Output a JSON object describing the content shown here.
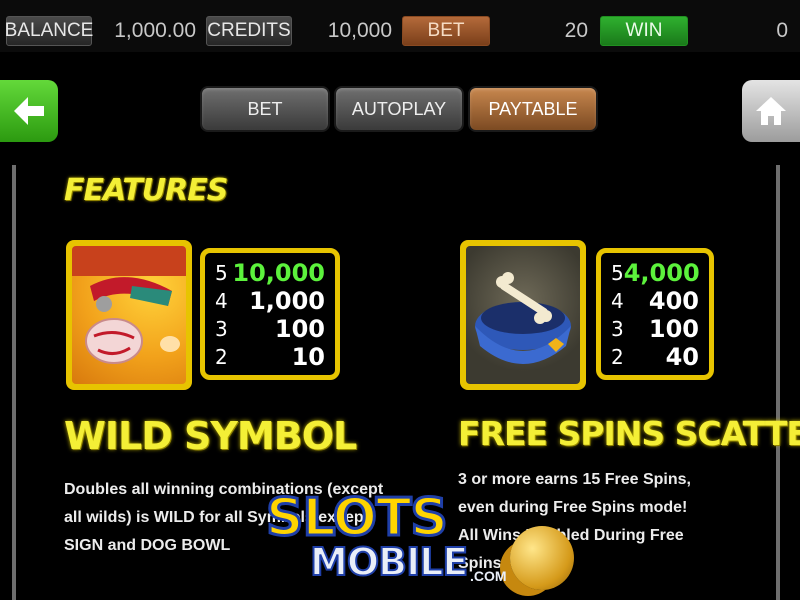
{
  "topbar": {
    "balance_label": "BALANCE",
    "balance_value": "1,000.00",
    "credits_label": "CREDITS",
    "credits_value": "10,000",
    "bet_label": "BET",
    "bet_value": "20",
    "win_label": "WIN",
    "win_value": "0"
  },
  "nav": {
    "tabs": [
      "BET",
      "AUTOPLAY",
      "PAYTABLE"
    ],
    "active_tab": "PAYTABLE"
  },
  "section_title": "FEATURES",
  "wild": {
    "title": "WILD SYMBOL",
    "paytable": [
      {
        "count": "5",
        "value": "10,000"
      },
      {
        "count": "4",
        "value": "1,000"
      },
      {
        "count": "3",
        "value": "100"
      },
      {
        "count": "2",
        "value": "10"
      }
    ],
    "description_lines": [
      "Doubles all winning combinations (except",
      "all wilds) is WILD for all Symbols except",
      "SIGN and DOG BOWL"
    ]
  },
  "scatter": {
    "title": "FREE SPINS SCATTER",
    "paytable": [
      {
        "count": "5",
        "value": "4,000"
      },
      {
        "count": "4",
        "value": "400"
      },
      {
        "count": "3",
        "value": "100"
      },
      {
        "count": "2",
        "value": "40"
      }
    ],
    "description_lines": [
      "3 or more earns 15 Free Spins,",
      "even during Free Spins mode!",
      "All Wins Doubled During Free",
      "Spins!"
    ]
  },
  "watermark": {
    "line1": "SLOTS",
    "line2": "MOBILE",
    "suffix": ".COM"
  },
  "colors": {
    "title_yellow": "#f4ef36",
    "frame_gold": "#e7c400",
    "top_payout_green": "#5cf23c",
    "bet_orange": "#b46a3a",
    "win_green": "#2fb02f",
    "back_green": "#4cc21f"
  },
  "icons": {
    "back": "arrow-left-icon",
    "home": "home-icon"
  }
}
